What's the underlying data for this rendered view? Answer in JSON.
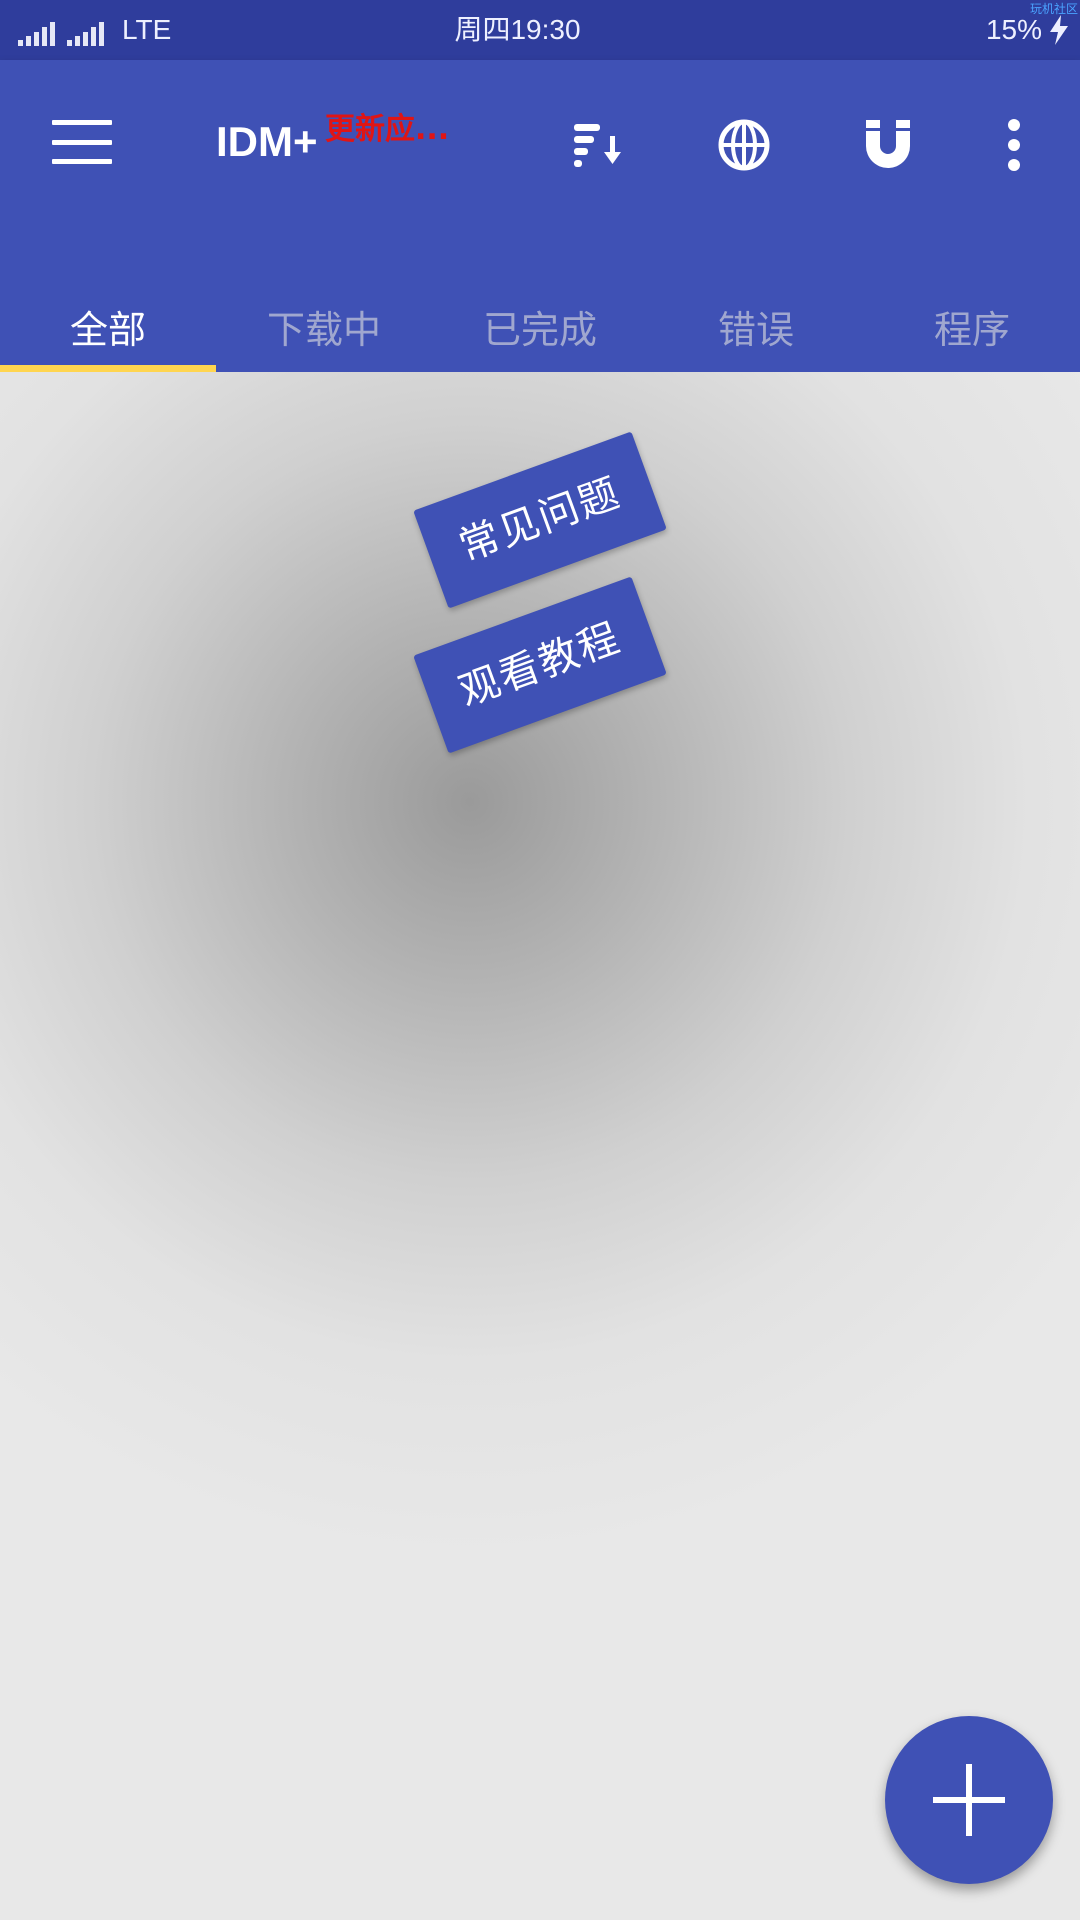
{
  "status_bar": {
    "network_type": "LTE",
    "clock": "周四19:30",
    "battery_percent": "15%",
    "corner_watermark": "玩机社区"
  },
  "app_bar": {
    "title": "IDM+",
    "update_badge": "更新应...",
    "icons": [
      "menu-icon",
      "sort-icon",
      "browser-globe-icon",
      "magnet-icon",
      "more-vert-icon"
    ]
  },
  "tabs": [
    {
      "label": "全部",
      "active": true
    },
    {
      "label": "下载中",
      "active": false
    },
    {
      "label": "已完成",
      "active": false
    },
    {
      "label": "错误",
      "active": false
    },
    {
      "label": "程序",
      "active": false
    }
  ],
  "help_buttons": {
    "faq_label": "常见问题",
    "tutorial_label": "观看教程"
  },
  "fab": {
    "icon": "add-icon"
  },
  "colors": {
    "status_bar": "#2f3d9c",
    "primary": "#3f51b5",
    "tab_indicator": "#ffd54f",
    "update_badge": "#e01515",
    "background": "#e8e8e8"
  }
}
